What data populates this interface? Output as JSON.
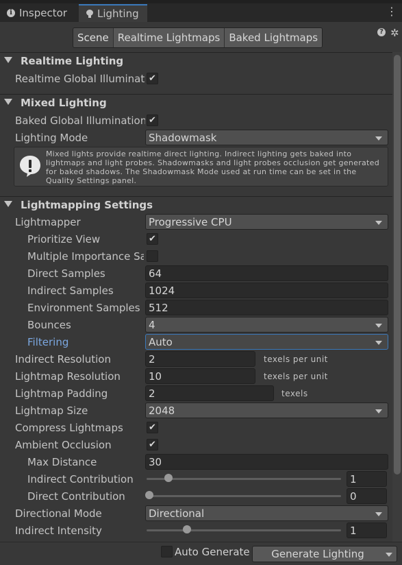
{
  "tabs": {
    "inspector": "Inspector",
    "lighting": "Lighting"
  },
  "toolbar": {
    "scene": "Scene",
    "realtime_lightmaps": "Realtime Lightmaps",
    "baked_lightmaps": "Baked Lightmaps"
  },
  "realtime": {
    "title": "Realtime Lighting",
    "gi_label": "Realtime Global Illuminatior",
    "gi_checked": true
  },
  "mixed": {
    "title": "Mixed Lighting",
    "baked_gi_label": "Baked Global Illumination",
    "baked_gi_checked": true,
    "mode_label": "Lighting Mode",
    "mode_value": "Shadowmask",
    "help_text": "Mixed lights provide realtime direct lighting. Indirect lighting gets baked into lightmaps and light probes. Shadowmasks and light probes occlusion get generated for baked shadows. The Shadowmask Mode used at run time can be set in the Quality Settings panel."
  },
  "lightmapping": {
    "title": "Lightmapping Settings",
    "lightmapper_label": "Lightmapper",
    "lightmapper_value": "Progressive CPU",
    "prioritize_label": "Prioritize View",
    "prioritize_checked": true,
    "mis_label": "Multiple Importance Sampling",
    "mis_checked": false,
    "direct_samples_label": "Direct Samples",
    "direct_samples_value": "64",
    "indirect_samples_label": "Indirect Samples",
    "indirect_samples_value": "1024",
    "env_samples_label": "Environment Samples",
    "env_samples_value": "512",
    "bounces_label": "Bounces",
    "bounces_value": "4",
    "filtering_label": "Filtering",
    "filtering_value": "Auto",
    "indirect_res_label": "Indirect Resolution",
    "indirect_res_value": "2",
    "indirect_res_unit": "texels per unit",
    "lightmap_res_label": "Lightmap Resolution",
    "lightmap_res_value": "10",
    "lightmap_res_unit": "texels per unit",
    "padding_label": "Lightmap Padding",
    "padding_value": "2",
    "padding_unit": "texels",
    "size_label": "Lightmap Size",
    "size_value": "2048",
    "compress_label": "Compress Lightmaps",
    "compress_checked": true,
    "ao_label": "Ambient Occlusion",
    "ao_checked": true,
    "max_distance_label": "Max Distance",
    "max_distance_value": "30",
    "indirect_contrib_label": "Indirect Contribution",
    "indirect_contrib_value": "1",
    "indirect_contrib_fraction": 0.1,
    "direct_contrib_label": "Direct Contribution",
    "direct_contrib_value": "0",
    "direct_contrib_fraction": 0.0,
    "directional_mode_label": "Directional Mode",
    "directional_mode_value": "Directional",
    "indirect_intensity_label": "Indirect Intensity",
    "indirect_intensity_value": "1",
    "indirect_intensity_fraction": 0.2
  },
  "footer": {
    "auto_generate_label": "Auto Generate",
    "auto_generate_checked": false,
    "generate_label": "Generate Lighting"
  },
  "colors": {
    "background": "#383838",
    "accent": "#3a79bb",
    "link_label": "#7ba7e0"
  }
}
